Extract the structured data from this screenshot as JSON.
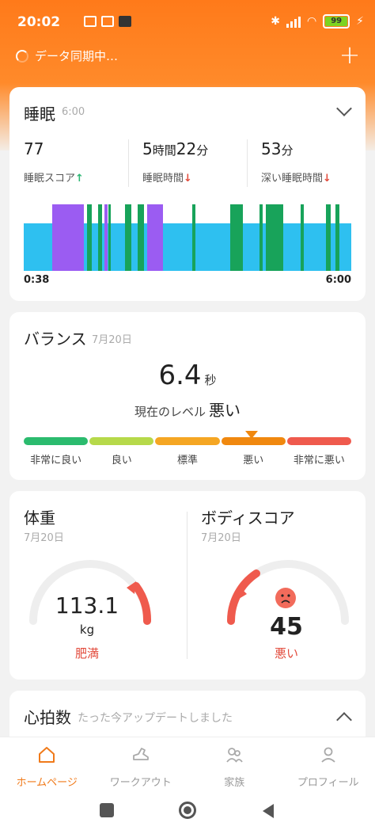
{
  "status_bar": {
    "time": "20:02",
    "battery": "99"
  },
  "top": {
    "sync_text": "データ同期中…"
  },
  "sleep": {
    "title": "睡眠",
    "time": "6:00",
    "score_value": "77",
    "score_label": "睡眠スコア",
    "duration_h": "5",
    "duration_h_unit": "時間",
    "duration_m": "22",
    "duration_m_unit": "分",
    "duration_label": "睡眠時間",
    "deep_value": "53",
    "deep_unit": "分",
    "deep_label": "深い睡眠時間",
    "start_time": "0:38",
    "end_time": "6:00",
    "colors": {
      "light": "#2ec0f0",
      "rem": "#9b5cf2",
      "deep": "#18a35a"
    }
  },
  "balance": {
    "title": "バランス",
    "date": "7月20日",
    "value": "6.4",
    "unit": "秒",
    "level_prefix": "現在のレベル",
    "level": "悪い",
    "scale": [
      {
        "label": "非常に良い",
        "color": "#2bbb6e"
      },
      {
        "label": "良い",
        "color": "#b6d94a"
      },
      {
        "label": "標準",
        "color": "#f5a623"
      },
      {
        "label": "悪い",
        "color": "#f0880f"
      },
      {
        "label": "非常に悪い",
        "color": "#ef5a4d"
      }
    ]
  },
  "weight": {
    "title": "体重",
    "date": "7月20日",
    "value": "113.1",
    "unit": "kg",
    "status": "肥満"
  },
  "body_score": {
    "title": "ボディスコア",
    "date": "7月20日",
    "value": "45",
    "status": "悪い"
  },
  "heart": {
    "title": "心拍数",
    "updated": "たった今アップデートしました"
  },
  "nav": {
    "home": "ホームページ",
    "workout": "ワークアウト",
    "family": "家族",
    "profile": "プロフィール"
  }
}
